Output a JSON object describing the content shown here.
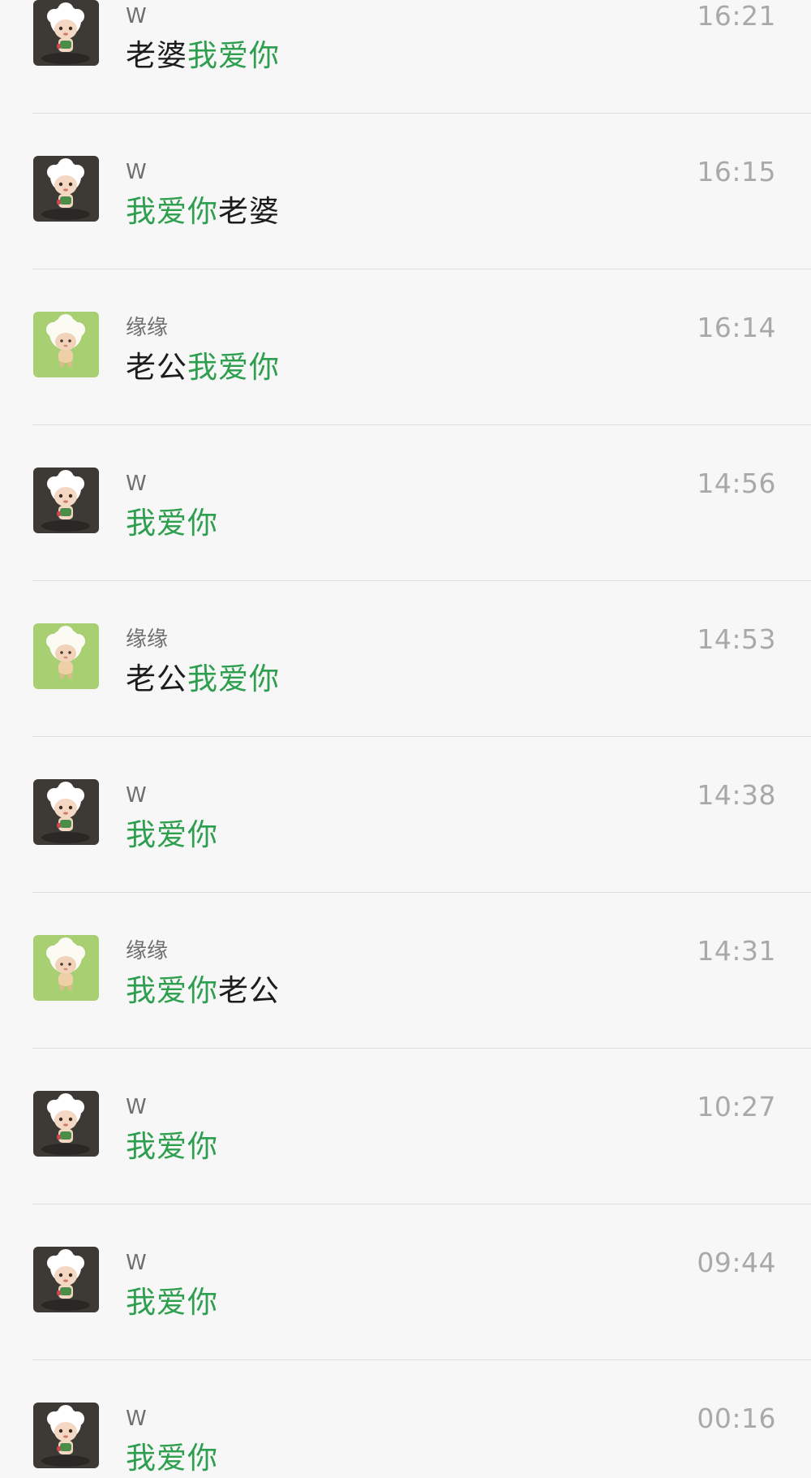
{
  "colors": {
    "highlight": "#2e9e4f",
    "text": "#1c1c1c",
    "sender": "#6f6f6f",
    "time": "#a9a9a9",
    "background": "#f7f7f7",
    "divider": "#dfdfdf"
  },
  "search_results": [
    {
      "sender": "W",
      "time": "16:21",
      "avatar_icon": "sheep-avatar-dark-icon",
      "message": [
        {
          "text": "老婆",
          "highlight": false
        },
        {
          "text": "我爱你",
          "highlight": true
        }
      ]
    },
    {
      "sender": "W",
      "time": "16:15",
      "avatar_icon": "sheep-avatar-dark-icon",
      "message": [
        {
          "text": "我爱你",
          "highlight": true
        },
        {
          "text": "老婆",
          "highlight": false
        }
      ]
    },
    {
      "sender": "缘缘",
      "time": "16:14",
      "avatar_icon": "sheep-avatar-green-icon",
      "message": [
        {
          "text": "老公",
          "highlight": false
        },
        {
          "text": "我爱你",
          "highlight": true
        }
      ]
    },
    {
      "sender": "W",
      "time": "14:56",
      "avatar_icon": "sheep-avatar-dark-icon",
      "message": [
        {
          "text": "我爱你",
          "highlight": true
        }
      ]
    },
    {
      "sender": "缘缘",
      "time": "14:53",
      "avatar_icon": "sheep-avatar-green-icon",
      "message": [
        {
          "text": "老公",
          "highlight": false
        },
        {
          "text": "我爱你",
          "highlight": true
        }
      ]
    },
    {
      "sender": "W",
      "time": "14:38",
      "avatar_icon": "sheep-avatar-dark-icon",
      "message": [
        {
          "text": "我爱你",
          "highlight": true
        }
      ]
    },
    {
      "sender": "缘缘",
      "time": "14:31",
      "avatar_icon": "sheep-avatar-green-icon",
      "message": [
        {
          "text": "我爱你",
          "highlight": true
        },
        {
          "text": "老公",
          "highlight": false
        }
      ]
    },
    {
      "sender": "W",
      "time": "10:27",
      "avatar_icon": "sheep-avatar-dark-icon",
      "message": [
        {
          "text": "我爱你",
          "highlight": true
        }
      ]
    },
    {
      "sender": "W",
      "time": "09:44",
      "avatar_icon": "sheep-avatar-dark-icon",
      "message": [
        {
          "text": "我爱你",
          "highlight": true
        }
      ]
    },
    {
      "sender": "W",
      "time": "00:16",
      "avatar_icon": "sheep-avatar-dark-icon",
      "message": [
        {
          "text": "我爱你",
          "highlight": true
        }
      ]
    }
  ]
}
